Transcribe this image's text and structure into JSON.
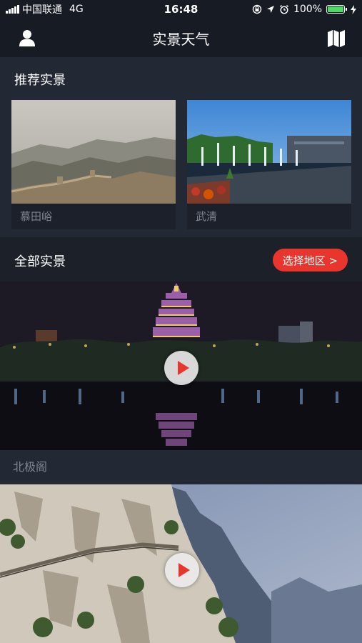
{
  "status_bar": {
    "carrier": "中国联通",
    "network": "4G",
    "time": "16:48",
    "battery_percent": "100%",
    "battery_level": 1.0,
    "battery_color": "#4cd964",
    "icons": [
      "signal-icon",
      "orientation-lock-icon",
      "location-icon",
      "alarm-icon",
      "battery-icon",
      "charging-icon"
    ]
  },
  "nav": {
    "title": "实景天气",
    "left_icon": "user-icon",
    "right_icon": "map-icon"
  },
  "recommended": {
    "title": "推荐实景",
    "items": [
      {
        "label": "慕田峪",
        "image": "great-wall-photo"
      },
      {
        "label": "武清",
        "image": "fountain-plaza-photo"
      }
    ]
  },
  "all": {
    "title": "全部实景",
    "region_button": "选择地区 >",
    "items": [
      {
        "label": "北极阁",
        "image": "night-pagoda-photo",
        "play_icon": "play-icon"
      },
      {
        "label": "",
        "image": "mountain-cliff-path-photo",
        "play_icon": "play-icon"
      }
    ]
  },
  "colors": {
    "accent": "#e8362e",
    "background": "#1b2029",
    "bar": "#171b24",
    "panel": "#222834",
    "muted_text": "#7f8591"
  }
}
